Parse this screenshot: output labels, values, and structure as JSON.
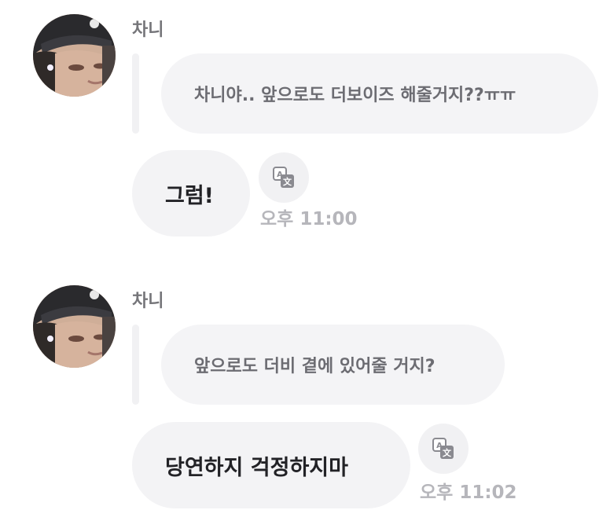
{
  "colors": {
    "bubble_background": "#f3f3f5",
    "name_text": "#757579",
    "quote_text": "#6c6c72",
    "reply_text": "#222226",
    "timestamp_text": "#b6b6bb"
  },
  "messages": [
    {
      "sender": "차니",
      "avatar_icon": "profile-photo-avatar",
      "quoted_message": "차니야.. 앞으로도 더보이즈 해줄거지??ㅠㅠ",
      "reply": "그럼!",
      "translate_icon": "translate-icon",
      "timestamp": "오후 11:00"
    },
    {
      "sender": "차니",
      "avatar_icon": "profile-photo-avatar",
      "quoted_message": "앞으로도 더비 곁에 있어줄 거지?",
      "reply": "당연하지 걱정하지마",
      "translate_icon": "translate-icon",
      "timestamp": "오후 11:02"
    }
  ]
}
